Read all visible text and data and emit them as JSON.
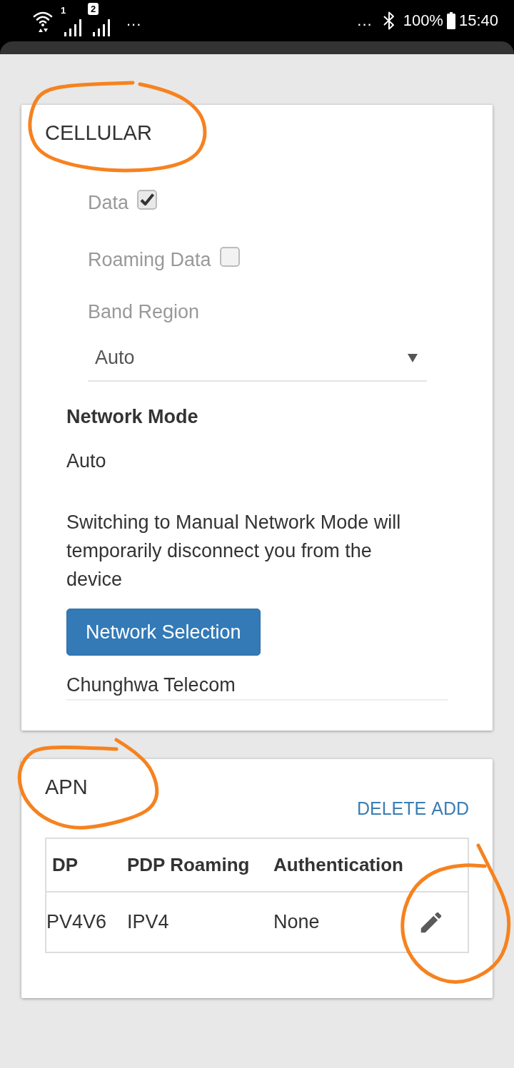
{
  "status_bar": {
    "signals": [
      {
        "sim": "1",
        "kind": "plain"
      },
      {
        "sim": "2",
        "kind": "badge"
      }
    ],
    "left_more": "...",
    "right_more": "...",
    "battery": "100%",
    "time": "15:40"
  },
  "cellular": {
    "title": "CELLULAR",
    "toggles": [
      {
        "label": "Data",
        "checked": true
      },
      {
        "label": "Roaming Data",
        "checked": false
      }
    ],
    "band_region": {
      "label": "Band Region",
      "value": "Auto"
    },
    "network_mode": {
      "label": "Network Mode",
      "value": "Auto"
    },
    "note": "Switching to Manual Network Mode will temporarily disconnect you from the device",
    "selection_button": "Network Selection",
    "operator": "Chunghwa Telecom"
  },
  "apn": {
    "title": "APN",
    "actions": [
      "DELETE",
      "ADD"
    ],
    "table": {
      "columns": [
        "DP",
        "PDP Roaming",
        "Authentication"
      ],
      "rows": [
        {
          "cells": [
            "PV4V6",
            "IPV4",
            "None"
          ]
        }
      ]
    }
  }
}
